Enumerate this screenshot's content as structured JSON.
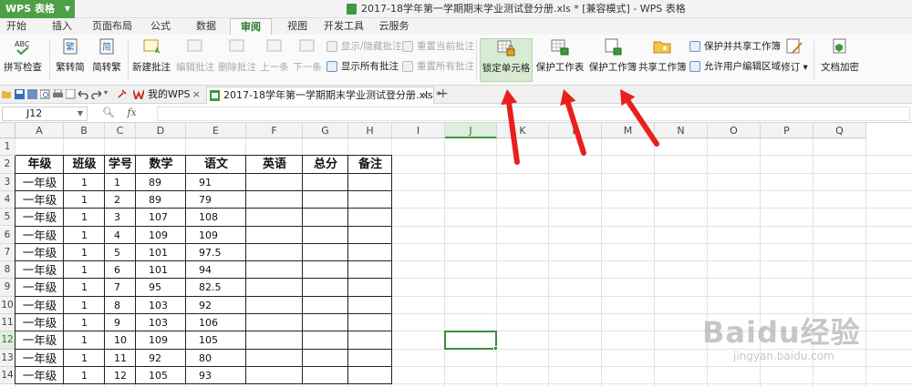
{
  "app": {
    "name": "WPS 表格",
    "window_title": "2017-18学年第一学期期末学业测试登分册.xls * [兼容模式] - WPS 表格",
    "accent": "#4ea046"
  },
  "menu_tabs": [
    "开始",
    "插入",
    "页面布局",
    "公式",
    "数据",
    "审阅",
    "视图",
    "开发工具",
    "云服务"
  ],
  "active_menu_tab": "审阅",
  "ribbon": {
    "spell_check": "拼写检查",
    "trad_to_simp": "繁转简",
    "simp_to_trad": "简转繁",
    "new_comment": "新建批注",
    "edit_comment": "编辑批注",
    "delete_comment": "删除批注",
    "prev": "上一条",
    "next": "下一条",
    "show_hide_comments": "显示/隐藏批注",
    "show_all_comments": "显示所有批注",
    "reset_current_comment": "重置当前批注",
    "reset_all_comments": "重置所有批注",
    "lock_cells": "锁定单元格",
    "protect_sheet": "保护工作表",
    "protect_workbook": "保护工作簿",
    "share_workbook": "共享工作簿",
    "protect_share_workbook": "保护并共享工作簿",
    "allow_edit_ranges": "允许用户编辑区域",
    "track_changes": "修订",
    "doc_encrypt": "文档加密"
  },
  "doc_tabs": [
    {
      "label": "我的WPS"
    },
    {
      "label": "2017-18学年第一学期期末学业测试登分册.xls *"
    }
  ],
  "formula_bar": {
    "cell_ref": "J12",
    "fx": "fx",
    "value": ""
  },
  "columns": [
    "A",
    "B",
    "C",
    "D",
    "E",
    "F",
    "G",
    "H",
    "I",
    "J",
    "K",
    "L",
    "M",
    "N",
    "O",
    "P",
    "Q"
  ],
  "selected_column": "J",
  "row_numbers": [
    "1",
    "2",
    "3",
    "4",
    "5",
    "6",
    "7",
    "8",
    "9",
    "10",
    "11",
    "12",
    "13",
    "14"
  ],
  "selected_row": "12",
  "table": {
    "headers": [
      "年级",
      "班级",
      "学号",
      "数学",
      "语文",
      "英语",
      "总分",
      "备注"
    ],
    "rows": [
      [
        "一年级",
        "1",
        "1",
        "89",
        "91",
        "",
        "",
        ""
      ],
      [
        "一年级",
        "1",
        "2",
        "89",
        "79",
        "",
        "",
        ""
      ],
      [
        "一年级",
        "1",
        "3",
        "107",
        "108",
        "",
        "",
        ""
      ],
      [
        "一年级",
        "1",
        "4",
        "109",
        "109",
        "",
        "",
        ""
      ],
      [
        "一年级",
        "1",
        "5",
        "101",
        "97.5",
        "",
        "",
        ""
      ],
      [
        "一年级",
        "1",
        "6",
        "101",
        "94",
        "",
        "",
        ""
      ],
      [
        "一年级",
        "1",
        "7",
        "95",
        "82.5",
        "",
        "",
        ""
      ],
      [
        "一年级",
        "1",
        "8",
        "103",
        "92",
        "",
        "",
        ""
      ],
      [
        "一年级",
        "1",
        "9",
        "103",
        "106",
        "",
        "",
        ""
      ],
      [
        "一年级",
        "1",
        "10",
        "109",
        "105",
        "",
        "",
        ""
      ],
      [
        "一年级",
        "1",
        "11",
        "92",
        "80",
        "",
        "",
        ""
      ],
      [
        "一年级",
        "1",
        "12",
        "105",
        "93",
        "",
        "",
        ""
      ]
    ]
  },
  "watermark": {
    "main": "Baidu经验",
    "sub": "jingyan.baidu.com"
  },
  "annotation_color": "#e8201c"
}
